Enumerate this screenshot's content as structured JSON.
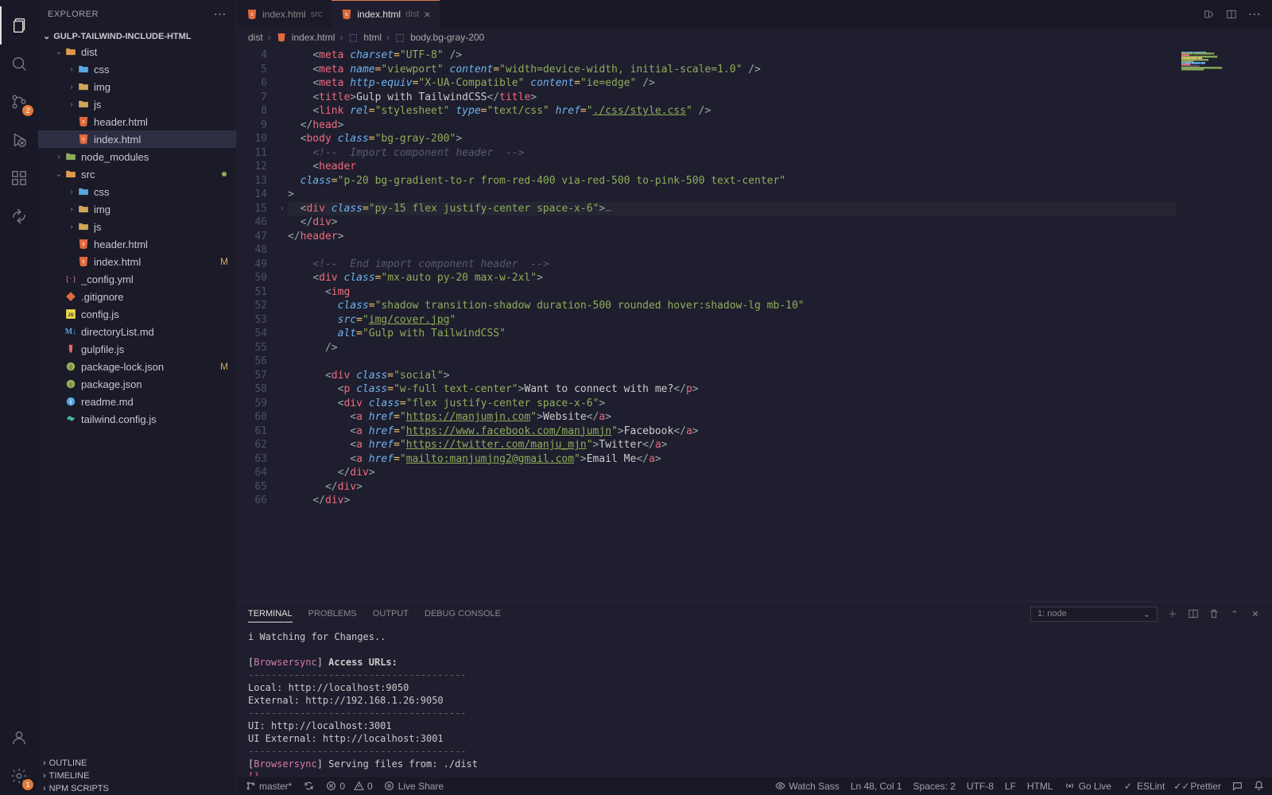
{
  "explorer_title": "EXPLORER",
  "project_name": "GULP-TAILWIND-INCLUDE-HTML",
  "tabs": [
    {
      "label": "index.html",
      "sub": "src",
      "active": false
    },
    {
      "label": "index.html",
      "sub": "dist",
      "active": true
    }
  ],
  "breadcrumb": {
    "p1": "dist",
    "p2": "index.html",
    "p3": "html",
    "p4": "body.bg-gray-200"
  },
  "tree": [
    {
      "l": 1,
      "type": "folder-open",
      "label": "dist",
      "chev": "down"
    },
    {
      "l": 2,
      "type": "folder",
      "label": "css",
      "chev": "right",
      "color": "#5aa6e0"
    },
    {
      "l": 2,
      "type": "folder",
      "label": "img",
      "chev": "right",
      "color": "#d0a65a"
    },
    {
      "l": 2,
      "type": "folder",
      "label": "js",
      "chev": "right",
      "color": "#d0a65a"
    },
    {
      "l": 2,
      "type": "html",
      "label": "header.html"
    },
    {
      "l": 2,
      "type": "html",
      "label": "index.html",
      "selected": true
    },
    {
      "l": 1,
      "type": "folder",
      "label": "node_modules",
      "chev": "right",
      "color": "#8aae5a"
    },
    {
      "l": 1,
      "type": "folder-open",
      "label": "src",
      "chev": "down",
      "mod": true
    },
    {
      "l": 2,
      "type": "folder",
      "label": "css",
      "chev": "right",
      "color": "#5aa6e0"
    },
    {
      "l": 2,
      "type": "folder",
      "label": "img",
      "chev": "right",
      "color": "#d0a65a"
    },
    {
      "l": 2,
      "type": "folder",
      "label": "js",
      "chev": "right",
      "color": "#d0a65a"
    },
    {
      "l": 2,
      "type": "html",
      "label": "header.html"
    },
    {
      "l": 2,
      "type": "html",
      "label": "index.html",
      "status": "M"
    },
    {
      "l": 1,
      "type": "yml",
      "label": "_config.yml"
    },
    {
      "l": 1,
      "type": "git",
      "label": ".gitignore"
    },
    {
      "l": 1,
      "type": "js",
      "label": "config.js"
    },
    {
      "l": 1,
      "type": "md",
      "label": "directoryList.md"
    },
    {
      "l": 1,
      "type": "gulp",
      "label": "gulpfile.js"
    },
    {
      "l": 1,
      "type": "json",
      "label": "package-lock.json",
      "status": "M"
    },
    {
      "l": 1,
      "type": "json",
      "label": "package.json"
    },
    {
      "l": 1,
      "type": "info",
      "label": "readme.md"
    },
    {
      "l": 1,
      "type": "tw",
      "label": "tailwind.config.js"
    }
  ],
  "outline": [
    "OUTLINE",
    "TIMELINE",
    "NPM SCRIPTS"
  ],
  "code_lines": [
    {
      "n": 4,
      "html": "    <span class='t-punc'>&lt;</span><span class='t-tag'>meta</span> <span class='t-attr'>charset</span><span class='t-op'>=</span><span class='t-str'>\"UTF-8\"</span> <span class='t-punc'>/&gt;</span>"
    },
    {
      "n": 5,
      "html": "    <span class='t-punc'>&lt;</span><span class='t-tag'>meta</span> <span class='t-attr'>name</span><span class='t-op'>=</span><span class='t-str'>\"viewport\"</span> <span class='t-attr'>content</span><span class='t-op'>=</span><span class='t-str'>\"width=device-width, initial-scale=1.0\"</span> <span class='t-punc'>/&gt;</span>"
    },
    {
      "n": 6,
      "html": "    <span class='t-punc'>&lt;</span><span class='t-tag'>meta</span> <span class='t-attr'>http-equiv</span><span class='t-op'>=</span><span class='t-str'>\"X-UA-Compatible\"</span> <span class='t-attr'>content</span><span class='t-op'>=</span><span class='t-str'>\"ie=edge\"</span> <span class='t-punc'>/&gt;</span>"
    },
    {
      "n": 7,
      "html": "    <span class='t-punc'>&lt;</span><span class='t-tag'>title</span><span class='t-punc'>&gt;</span>Gulp with TailwindCSS<span class='t-punc'>&lt;/</span><span class='t-tag'>title</span><span class='t-punc'>&gt;</span>"
    },
    {
      "n": 8,
      "html": "    <span class='t-punc'>&lt;</span><span class='t-tag'>link</span> <span class='t-attr'>rel</span><span class='t-op'>=</span><span class='t-str'>\"stylesheet\"</span> <span class='t-attr'>type</span><span class='t-op'>=</span><span class='t-str'>\"text/css\"</span> <span class='t-attr'>href</span><span class='t-op'>=</span><span class='t-str'>\"</span><span class='t-link'>./css/style.css</span><span class='t-str'>\"</span> <span class='t-punc'>/&gt;</span>"
    },
    {
      "n": 9,
      "html": "  <span class='t-punc'>&lt;/</span><span class='t-tag'>head</span><span class='t-punc'>&gt;</span>"
    },
    {
      "n": 10,
      "html": "  <span class='t-punc'>&lt;</span><span class='t-tag'>body</span> <span class='t-attr'>class</span><span class='t-op'>=</span><span class='t-str'>\"bg-gray-200\"</span><span class='t-punc'>&gt;</span>"
    },
    {
      "n": 11,
      "html": "    <span class='t-comment'>&lt;!--  Import component header  --&gt;</span>"
    },
    {
      "n": 12,
      "html": "    <span class='t-punc'>&lt;</span><span class='t-tag'>header</span>"
    },
    {
      "n": 13,
      "html": "  <span class='t-attr'>class</span><span class='t-op'>=</span><span class='t-str'>\"p-20 bg-gradient-to-r from-red-400 via-red-500 to-pink-500 text-center\"</span>"
    },
    {
      "n": 14,
      "html": "<span class='t-punc'>&gt;</span>"
    },
    {
      "n": 15,
      "fold": true,
      "hl": true,
      "html": "  <span class='t-punc'>&lt;</span><span class='t-tag'>div</span> <span class='t-attr'>class</span><span class='t-op'>=</span><span class='t-str'>\"py-15 flex justify-center space-x-6\"</span><span class='t-punc'>&gt;</span><span class='t-arrow'>&hellip;</span>"
    },
    {
      "n": 46,
      "html": "  <span class='t-punc'>&lt;/</span><span class='t-tag'>div</span><span class='t-punc'>&gt;</span>"
    },
    {
      "n": 47,
      "html": "<span class='t-punc'>&lt;/</span><span class='t-tag'>header</span><span class='t-punc'>&gt;</span>"
    },
    {
      "n": 48,
      "html": ""
    },
    {
      "n": 49,
      "html": "    <span class='t-comment'>&lt;!--  End import component header  --&gt;</span>"
    },
    {
      "n": 50,
      "html": "    <span class='t-punc'>&lt;</span><span class='t-tag'>div</span> <span class='t-attr'>class</span><span class='t-op'>=</span><span class='t-str'>\"mx-auto py-20 max-w-2xl\"</span><span class='t-punc'>&gt;</span>"
    },
    {
      "n": 51,
      "html": "      <span class='t-punc'>&lt;</span><span class='t-tag'>img</span>"
    },
    {
      "n": 52,
      "html": "        <span class='t-attr'>class</span><span class='t-op'>=</span><span class='t-str'>\"shadow transition-shadow duration-500 rounded hover:shadow-lg mb-10\"</span>"
    },
    {
      "n": 53,
      "html": "        <span class='t-attr'>src</span><span class='t-op'>=</span><span class='t-str'>\"</span><span class='t-link'>img/cover.jpg</span><span class='t-str'>\"</span>"
    },
    {
      "n": 54,
      "html": "        <span class='t-attr'>alt</span><span class='t-op'>=</span><span class='t-str'>\"Gulp with TailwindCSS\"</span>"
    },
    {
      "n": 55,
      "html": "      <span class='t-punc'>/&gt;</span>"
    },
    {
      "n": 56,
      "html": ""
    },
    {
      "n": 57,
      "html": "      <span class='t-punc'>&lt;</span><span class='t-tag'>div</span> <span class='t-attr'>class</span><span class='t-op'>=</span><span class='t-str'>\"social\"</span><span class='t-punc'>&gt;</span>"
    },
    {
      "n": 58,
      "html": "        <span class='t-punc'>&lt;</span><span class='t-tag'>p</span> <span class='t-attr'>class</span><span class='t-op'>=</span><span class='t-str'>\"w-full text-center\"</span><span class='t-punc'>&gt;</span>Want to connect with me?<span class='t-punc'>&lt;/</span><span class='t-tag'>p</span><span class='t-punc'>&gt;</span>"
    },
    {
      "n": 59,
      "html": "        <span class='t-punc'>&lt;</span><span class='t-tag'>div</span> <span class='t-attr'>class</span><span class='t-op'>=</span><span class='t-str'>\"flex justify-center space-x-6\"</span><span class='t-punc'>&gt;</span>"
    },
    {
      "n": 60,
      "html": "          <span class='t-punc'>&lt;</span><span class='t-tag'>a</span> <span class='t-attr'>href</span><span class='t-op'>=</span><span class='t-str'>\"</span><span class='t-link'>https://manjumjn.com</span><span class='t-str'>\"</span><span class='t-punc'>&gt;</span>Website<span class='t-punc'>&lt;/</span><span class='t-tag'>a</span><span class='t-punc'>&gt;</span>"
    },
    {
      "n": 61,
      "html": "          <span class='t-punc'>&lt;</span><span class='t-tag'>a</span> <span class='t-attr'>href</span><span class='t-op'>=</span><span class='t-str'>\"</span><span class='t-link'>https://www.facebook.com/manjumjn</span><span class='t-str'>\"</span><span class='t-punc'>&gt;</span>Facebook<span class='t-punc'>&lt;/</span><span class='t-tag'>a</span><span class='t-punc'>&gt;</span>"
    },
    {
      "n": 62,
      "html": "          <span class='t-punc'>&lt;</span><span class='t-tag'>a</span> <span class='t-attr'>href</span><span class='t-op'>=</span><span class='t-str'>\"</span><span class='t-link'>https://twitter.com/manju_mjn</span><span class='t-str'>\"</span><span class='t-punc'>&gt;</span>Twitter<span class='t-punc'>&lt;/</span><span class='t-tag'>a</span><span class='t-punc'>&gt;</span>"
    },
    {
      "n": 63,
      "html": "          <span class='t-punc'>&lt;</span><span class='t-tag'>a</span> <span class='t-attr'>href</span><span class='t-op'>=</span><span class='t-str'>\"</span><span class='t-link'>mailto:manjumjng2@gmail.com</span><span class='t-str'>\"</span><span class='t-punc'>&gt;</span>Email Me<span class='t-punc'>&lt;/</span><span class='t-tag'>a</span><span class='t-punc'>&gt;</span>"
    },
    {
      "n": 64,
      "html": "        <span class='t-punc'>&lt;/</span><span class='t-tag'>div</span><span class='t-punc'>&gt;</span>"
    },
    {
      "n": 65,
      "html": "      <span class='t-punc'>&lt;/</span><span class='t-tag'>div</span><span class='t-punc'>&gt;</span>"
    },
    {
      "n": 66,
      "html": "    <span class='t-punc'>&lt;/</span><span class='t-tag'>div</span><span class='t-punc'>&gt;</span>"
    }
  ],
  "panel": {
    "tabs": [
      "TERMINAL",
      "PROBLEMS",
      "OUTPUT",
      "DEBUG CONSOLE"
    ],
    "dropdown": "1: node",
    "lines": [
      "   i  Watching for Changes..",
      "",
      "[<span class='bs'>Browsersync</span>] <b>Access URLs:</b>",
      " <span class='dash'>--------------------------------------</span>",
      "       Local: <span class='url'>http://localhost:9050</span>",
      "    External: <span class='url'>http://192.168.1.26:9050</span>",
      " <span class='dash'>--------------------------------------</span>",
      "          UI: <span class='url'>http://localhost:3001</span>",
      " UI External: <span class='url'>http://localhost:3001</span>",
      " <span class='dash'>--------------------------------------</span>",
      "[<span class='bs'>Browsersync</span>] Serving files from: ./dist",
      "<span class='prompt'>[]</span>"
    ]
  },
  "status": {
    "branch": "master*",
    "errors": "0",
    "warnings": "0",
    "liveshare": "Live Share",
    "watchsass": "Watch Sass",
    "pos": "Ln 48, Col 1",
    "spaces": "Spaces: 2",
    "enc": "UTF-8",
    "eol": "LF",
    "lang": "HTML",
    "golive": "Go Live",
    "eslint": "ESLint",
    "prettier": "Prettier"
  },
  "badges": {
    "scm": "2",
    "settings": "1"
  }
}
